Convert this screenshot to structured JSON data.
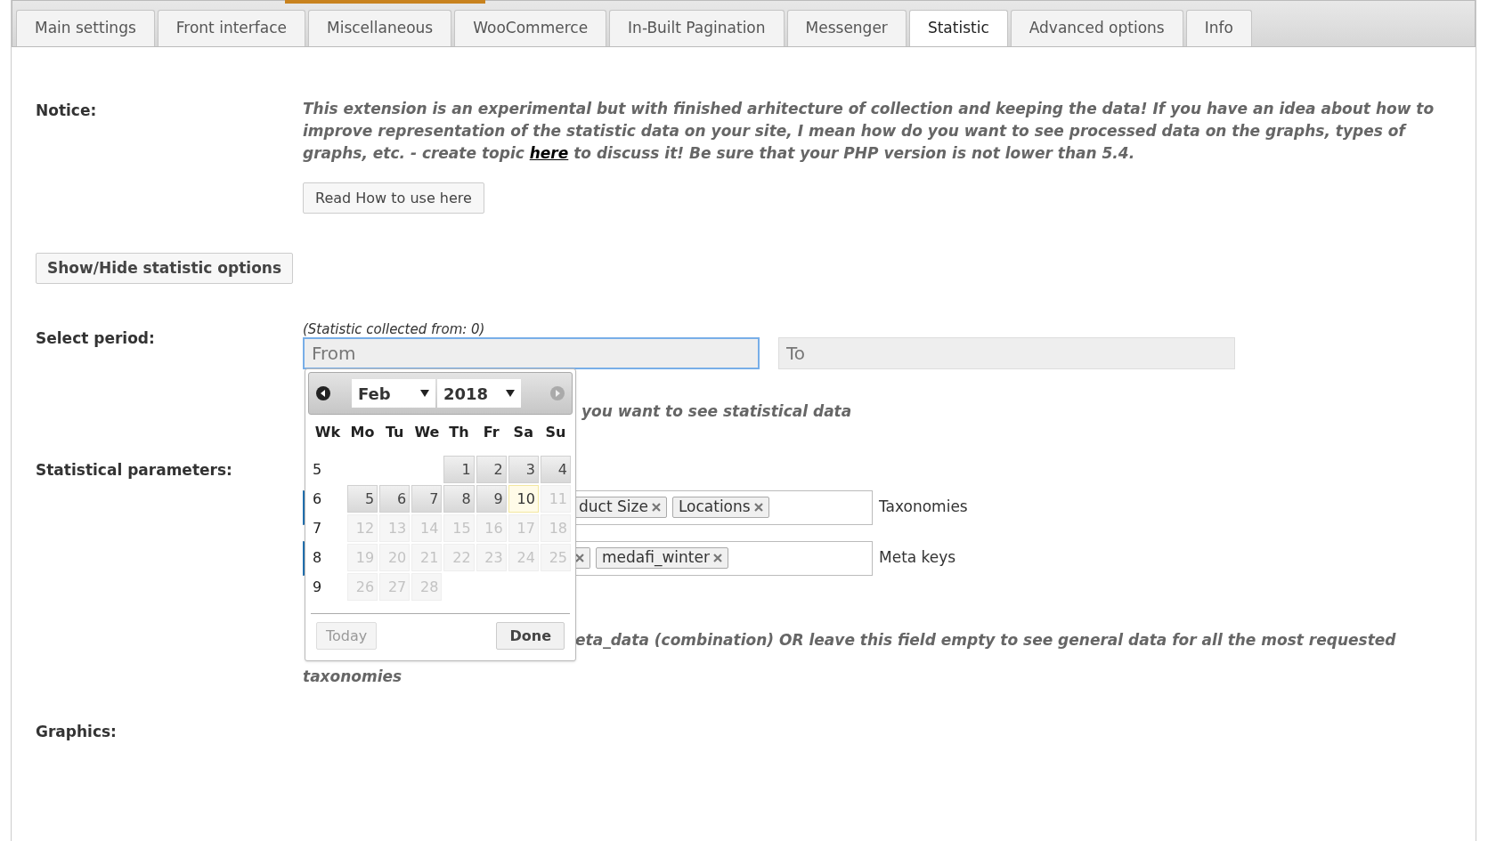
{
  "tabs": [
    {
      "label": "Main settings",
      "selected": false
    },
    {
      "label": "Front interface",
      "selected": false
    },
    {
      "label": "Miscellaneous",
      "selected": false
    },
    {
      "label": "WooCommerce",
      "selected": false
    },
    {
      "label": "In-Built Pagination",
      "selected": false
    },
    {
      "label": "Messenger",
      "selected": false
    },
    {
      "label": "Statistic",
      "selected": true
    },
    {
      "label": "Advanced options",
      "selected": false
    },
    {
      "label": "Info",
      "selected": false
    }
  ],
  "notice": {
    "label": "Notice:",
    "text_before": "This extension is an experimental but with finished arhitecture of collection and keeping the data! If you have an idea about how to improve representation of the statistic data on your site, I mean how do you want to see processed data on the graphs, types of graphs, etc. - create topic",
    "link": "here",
    "text_after": "to discuss it! Be sure that your PHP version is not lower than 5.4.",
    "button": "Read How to use here"
  },
  "toggle_button": "Show/Hide statistic options",
  "period": {
    "label": "Select period:",
    "collected": "(Statistic collected from: 0)",
    "from_placeholder": "From",
    "to_placeholder": "To",
    "hint": "you want to see statistical data"
  },
  "parameters": {
    "label": "Statistical parameters:",
    "fields": [
      {
        "tags": [
          {
            "label": "duct Size"
          },
          {
            "label": "Locations"
          }
        ],
        "suffix": "Taxonomies"
      },
      {
        "tags": [
          {
            "kind": "covered"
          },
          {
            "label": "medafi_winter"
          }
        ],
        "suffix": "Meta keys"
      }
    ],
    "hint_line": "eta_data (combination) OR leave this field empty to see general data for all the most requested",
    "hint_tail": "taxonomies"
  },
  "graphics": {
    "label": "Graphics:"
  },
  "datepicker": {
    "month": "Feb",
    "year": "2018",
    "weekdays": [
      "Wk",
      "Mo",
      "Tu",
      "We",
      "Th",
      "Fr",
      "Sa",
      "Su"
    ],
    "weeks": [
      {
        "week": "5",
        "days": [
          {
            "label": "1",
            "disabled": false,
            "today": false
          },
          {
            "label": "2",
            "disabled": false,
            "today": false
          },
          {
            "label": "3",
            "disabled": false,
            "today": false
          },
          {
            "label": "4",
            "disabled": false,
            "today": false
          }
        ]
      },
      {
        "week": "6",
        "days": [
          {
            "label": "5",
            "disabled": false,
            "today": false
          },
          {
            "label": "6",
            "disabled": false,
            "today": false
          },
          {
            "label": "7",
            "disabled": false,
            "today": false
          },
          {
            "label": "8",
            "disabled": false,
            "today": false
          },
          {
            "label": "9",
            "disabled": false,
            "today": false
          },
          {
            "label": "10",
            "disabled": false,
            "today": true
          },
          {
            "label": "11",
            "disabled": true,
            "today": false
          }
        ]
      },
      {
        "week": "7",
        "days": [
          {
            "label": "12",
            "disabled": true,
            "today": false
          },
          {
            "label": "13",
            "disabled": true,
            "today": false
          },
          {
            "label": "14",
            "disabled": true,
            "today": false
          },
          {
            "label": "15",
            "disabled": true,
            "today": false
          },
          {
            "label": "16",
            "disabled": true,
            "today": false
          },
          {
            "label": "17",
            "disabled": true,
            "today": false
          },
          {
            "label": "18",
            "disabled": true,
            "today": false
          }
        ]
      },
      {
        "week": "8",
        "days": [
          {
            "label": "19",
            "disabled": true,
            "today": false
          },
          {
            "label": "20",
            "disabled": true,
            "today": false
          },
          {
            "label": "21",
            "disabled": true,
            "today": false
          },
          {
            "label": "22",
            "disabled": true,
            "today": false
          },
          {
            "label": "23",
            "disabled": true,
            "today": false
          },
          {
            "label": "24",
            "disabled": true,
            "today": false
          },
          {
            "label": "25",
            "disabled": true,
            "today": false
          }
        ]
      },
      {
        "week": "9",
        "days": [
          {
            "label": "26",
            "disabled": true,
            "today": false
          },
          {
            "label": "27",
            "disabled": true,
            "today": false
          },
          {
            "label": "28",
            "disabled": true,
            "today": false
          }
        ]
      }
    ],
    "today_button": "Today",
    "done_button": "Done"
  }
}
